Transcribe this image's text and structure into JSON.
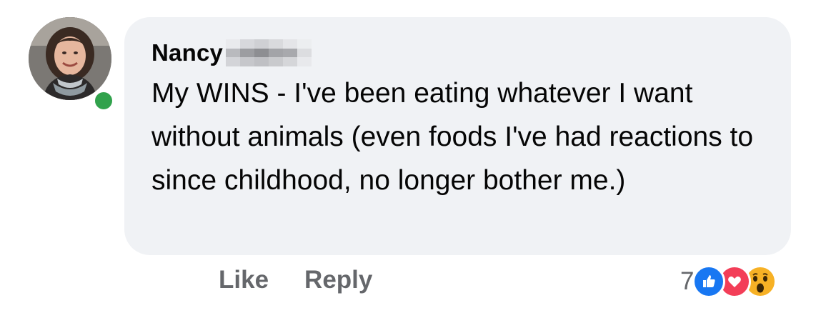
{
  "comment": {
    "author_name": "Nancy",
    "author_surname_blurred": true,
    "online_status_color": "#31a24c",
    "text": "My WINS - I've been eating whatever I want without animals (even foods I've had reactions to since childhood, no longer bother me.)"
  },
  "actions": {
    "like_label": "Like",
    "reply_label": "Reply"
  },
  "reactions": {
    "count": "7",
    "types": [
      "like-icon",
      "love-icon",
      "wow-icon"
    ]
  },
  "colors": {
    "bubble_bg": "#f0f2f5",
    "action_text": "#65676b",
    "like_blue": "#1877f2",
    "love_red": "#f33e58",
    "wow_yellow": "#f7b125"
  }
}
